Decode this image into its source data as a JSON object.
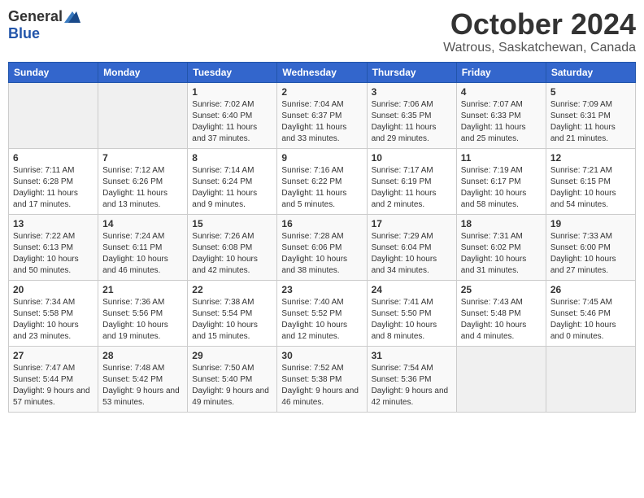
{
  "header": {
    "logo_general": "General",
    "logo_blue": "Blue",
    "month": "October 2024",
    "location": "Watrous, Saskatchewan, Canada"
  },
  "weekdays": [
    "Sunday",
    "Monday",
    "Tuesday",
    "Wednesday",
    "Thursday",
    "Friday",
    "Saturday"
  ],
  "weeks": [
    [
      {
        "day": "",
        "info": ""
      },
      {
        "day": "",
        "info": ""
      },
      {
        "day": "1",
        "info": "Sunrise: 7:02 AM\nSunset: 6:40 PM\nDaylight: 11 hours and 37 minutes."
      },
      {
        "day": "2",
        "info": "Sunrise: 7:04 AM\nSunset: 6:37 PM\nDaylight: 11 hours and 33 minutes."
      },
      {
        "day": "3",
        "info": "Sunrise: 7:06 AM\nSunset: 6:35 PM\nDaylight: 11 hours and 29 minutes."
      },
      {
        "day": "4",
        "info": "Sunrise: 7:07 AM\nSunset: 6:33 PM\nDaylight: 11 hours and 25 minutes."
      },
      {
        "day": "5",
        "info": "Sunrise: 7:09 AM\nSunset: 6:31 PM\nDaylight: 11 hours and 21 minutes."
      }
    ],
    [
      {
        "day": "6",
        "info": "Sunrise: 7:11 AM\nSunset: 6:28 PM\nDaylight: 11 hours and 17 minutes."
      },
      {
        "day": "7",
        "info": "Sunrise: 7:12 AM\nSunset: 6:26 PM\nDaylight: 11 hours and 13 minutes."
      },
      {
        "day": "8",
        "info": "Sunrise: 7:14 AM\nSunset: 6:24 PM\nDaylight: 11 hours and 9 minutes."
      },
      {
        "day": "9",
        "info": "Sunrise: 7:16 AM\nSunset: 6:22 PM\nDaylight: 11 hours and 5 minutes."
      },
      {
        "day": "10",
        "info": "Sunrise: 7:17 AM\nSunset: 6:19 PM\nDaylight: 11 hours and 2 minutes."
      },
      {
        "day": "11",
        "info": "Sunrise: 7:19 AM\nSunset: 6:17 PM\nDaylight: 10 hours and 58 minutes."
      },
      {
        "day": "12",
        "info": "Sunrise: 7:21 AM\nSunset: 6:15 PM\nDaylight: 10 hours and 54 minutes."
      }
    ],
    [
      {
        "day": "13",
        "info": "Sunrise: 7:22 AM\nSunset: 6:13 PM\nDaylight: 10 hours and 50 minutes."
      },
      {
        "day": "14",
        "info": "Sunrise: 7:24 AM\nSunset: 6:11 PM\nDaylight: 10 hours and 46 minutes."
      },
      {
        "day": "15",
        "info": "Sunrise: 7:26 AM\nSunset: 6:08 PM\nDaylight: 10 hours and 42 minutes."
      },
      {
        "day": "16",
        "info": "Sunrise: 7:28 AM\nSunset: 6:06 PM\nDaylight: 10 hours and 38 minutes."
      },
      {
        "day": "17",
        "info": "Sunrise: 7:29 AM\nSunset: 6:04 PM\nDaylight: 10 hours and 34 minutes."
      },
      {
        "day": "18",
        "info": "Sunrise: 7:31 AM\nSunset: 6:02 PM\nDaylight: 10 hours and 31 minutes."
      },
      {
        "day": "19",
        "info": "Sunrise: 7:33 AM\nSunset: 6:00 PM\nDaylight: 10 hours and 27 minutes."
      }
    ],
    [
      {
        "day": "20",
        "info": "Sunrise: 7:34 AM\nSunset: 5:58 PM\nDaylight: 10 hours and 23 minutes."
      },
      {
        "day": "21",
        "info": "Sunrise: 7:36 AM\nSunset: 5:56 PM\nDaylight: 10 hours and 19 minutes."
      },
      {
        "day": "22",
        "info": "Sunrise: 7:38 AM\nSunset: 5:54 PM\nDaylight: 10 hours and 15 minutes."
      },
      {
        "day": "23",
        "info": "Sunrise: 7:40 AM\nSunset: 5:52 PM\nDaylight: 10 hours and 12 minutes."
      },
      {
        "day": "24",
        "info": "Sunrise: 7:41 AM\nSunset: 5:50 PM\nDaylight: 10 hours and 8 minutes."
      },
      {
        "day": "25",
        "info": "Sunrise: 7:43 AM\nSunset: 5:48 PM\nDaylight: 10 hours and 4 minutes."
      },
      {
        "day": "26",
        "info": "Sunrise: 7:45 AM\nSunset: 5:46 PM\nDaylight: 10 hours and 0 minutes."
      }
    ],
    [
      {
        "day": "27",
        "info": "Sunrise: 7:47 AM\nSunset: 5:44 PM\nDaylight: 9 hours and 57 minutes."
      },
      {
        "day": "28",
        "info": "Sunrise: 7:48 AM\nSunset: 5:42 PM\nDaylight: 9 hours and 53 minutes."
      },
      {
        "day": "29",
        "info": "Sunrise: 7:50 AM\nSunset: 5:40 PM\nDaylight: 9 hours and 49 minutes."
      },
      {
        "day": "30",
        "info": "Sunrise: 7:52 AM\nSunset: 5:38 PM\nDaylight: 9 hours and 46 minutes."
      },
      {
        "day": "31",
        "info": "Sunrise: 7:54 AM\nSunset: 5:36 PM\nDaylight: 9 hours and 42 minutes."
      },
      {
        "day": "",
        "info": ""
      },
      {
        "day": "",
        "info": ""
      }
    ]
  ]
}
